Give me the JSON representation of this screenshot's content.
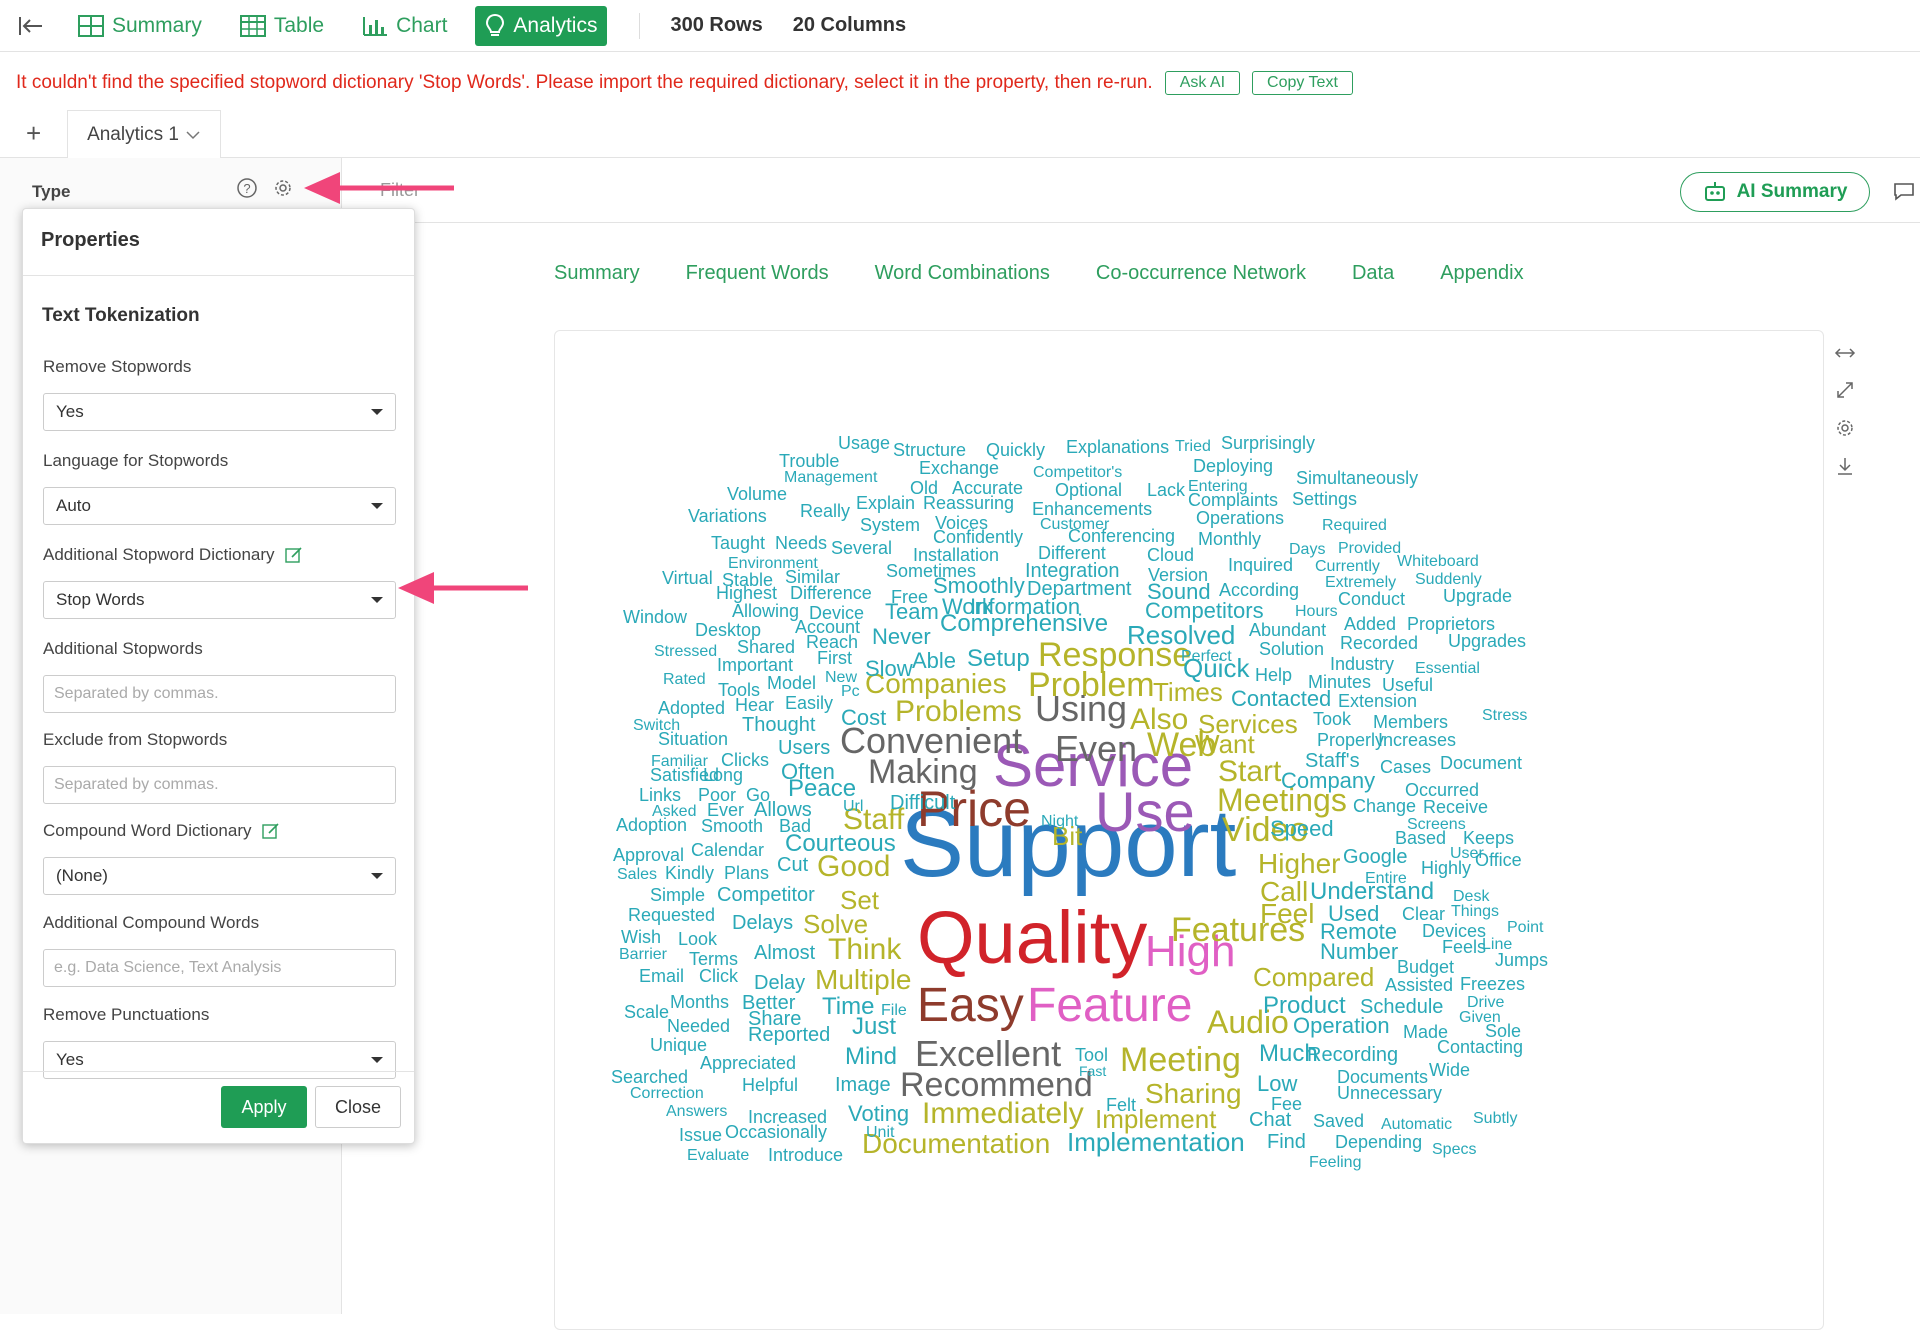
{
  "nav": {
    "summary": "Summary",
    "table": "Table",
    "chart": "Chart",
    "analytics": "Analytics",
    "rows": "300 Rows",
    "columns": "20 Columns"
  },
  "error": {
    "message": "It couldn't find the specified stopword dictionary 'Stop Words'. Please import the required dictionary, select it in the property, then re-run.",
    "ask_ai": "Ask AI",
    "copy_text": "Copy Text"
  },
  "tabs": {
    "add": "+",
    "current": "Analytics 1"
  },
  "toolbar": {
    "type_label": "Type",
    "filter_label": "Filter",
    "ai_summary": "AI Summary"
  },
  "subtabs": [
    "Summary",
    "Frequent Words",
    "Word Combinations",
    "Co-occurrence Network",
    "Data",
    "Appendix"
  ],
  "properties": {
    "title": "Properties",
    "section": "Text Tokenization",
    "remove_stopwords": {
      "label": "Remove Stopwords",
      "value": "Yes"
    },
    "language": {
      "label": "Language for Stopwords",
      "value": "Auto"
    },
    "stopword_dict": {
      "label": "Additional Stopword Dictionary",
      "value": "Stop Words"
    },
    "additional_stopwords": {
      "label": "Additional Stopwords",
      "placeholder": "Separated by commas."
    },
    "exclude_stopwords": {
      "label": "Exclude from Stopwords",
      "placeholder": "Separated by commas."
    },
    "compound_dict": {
      "label": "Compound Word Dictionary",
      "value": "(None)"
    },
    "additional_compound": {
      "label": "Additional Compound Words",
      "placeholder": "e.g. Data Science, Text Analysis"
    },
    "remove_punct": {
      "label": "Remove Punctuations",
      "value": "Yes"
    },
    "apply": "Apply",
    "close": "Close"
  },
  "colors": {
    "accent": "#1f9d55",
    "error": "#e0281b",
    "arrow": "#f0457a"
  },
  "wordcloud": [
    {
      "t": "Support",
      "c": "#2b7bbf"
    },
    {
      "t": "Quality",
      "c": "#d1232a"
    },
    {
      "t": "Service",
      "c": "#9b59b6"
    },
    {
      "t": "Use",
      "c": "#9b59b6"
    },
    {
      "t": "Price",
      "c": "#8e3b2c"
    },
    {
      "t": "Easy",
      "c": "#8e3b2c"
    },
    {
      "t": "Feature",
      "c": "#e05fc4"
    },
    {
      "t": "High",
      "c": "#e05fc4"
    },
    {
      "t": "Features",
      "c": "#b5b42a"
    },
    {
      "t": "Excellent",
      "c": "#666666"
    },
    {
      "t": "Recommend",
      "c": "#666666"
    },
    {
      "t": "Meeting",
      "c": "#b5b42a"
    },
    {
      "t": "Audio",
      "c": "#b5b42a"
    },
    {
      "t": "Video",
      "c": "#b5b42a"
    },
    {
      "t": "Meetings",
      "c": "#b5b42a"
    },
    {
      "t": "Response",
      "c": "#b5b42a"
    },
    {
      "t": "Problem",
      "c": "#b5b42a"
    },
    {
      "t": "Using",
      "c": "#666666"
    },
    {
      "t": "Convenient",
      "c": "#666666"
    },
    {
      "t": "Even",
      "c": "#666666"
    },
    {
      "t": "Web",
      "c": "#b5b42a"
    },
    {
      "t": "Making",
      "c": "#666666"
    },
    {
      "t": "Immediately",
      "c": "#b5b42a"
    },
    {
      "t": "Documentation",
      "c": "#b5b42a"
    },
    {
      "t": "Implementation",
      "c": "#2aa9b8"
    },
    {
      "t": "Sharing",
      "c": "#b5b42a"
    },
    {
      "t": "Implement",
      "c": "#b5b42a"
    },
    {
      "t": "Multiple",
      "c": "#b5b42a"
    },
    {
      "t": "Think",
      "c": "#b5b42a"
    },
    {
      "t": "Staff",
      "c": "#b5b42a"
    },
    {
      "t": "Good",
      "c": "#b5b42a"
    },
    {
      "t": "Companies",
      "c": "#b5b42a"
    },
    {
      "t": "Problems",
      "c": "#b5b42a"
    },
    {
      "t": "Also",
      "c": "#b5b42a"
    },
    {
      "t": "Services",
      "c": "#b5b42a"
    },
    {
      "t": "Start",
      "c": "#b5b42a"
    },
    {
      "t": "Want",
      "c": "#b5b42a"
    },
    {
      "t": "Times",
      "c": "#b5b42a"
    },
    {
      "t": "Higher",
      "c": "#b5b42a"
    },
    {
      "t": "Call",
      "c": "#b5b42a"
    },
    {
      "t": "Feel",
      "c": "#b5b42a"
    },
    {
      "t": "Compared",
      "c": "#b5b42a"
    },
    {
      "t": "Solve",
      "c": "#b5b42a"
    },
    {
      "t": "Set",
      "c": "#b5b42a"
    },
    {
      "t": "Bit",
      "c": "#b5b42a"
    },
    {
      "t": "Resolved",
      "c": "#2aa9b8"
    },
    {
      "t": "Quick",
      "c": "#2aa9b8"
    },
    {
      "t": "Comprehensive",
      "c": "#2aa9b8"
    },
    {
      "t": "Courteous",
      "c": "#2aa9b8"
    },
    {
      "t": "Peace",
      "c": "#2aa9b8"
    },
    {
      "t": "Often",
      "c": "#2aa9b8"
    },
    {
      "t": "Cost",
      "c": "#2aa9b8"
    },
    {
      "t": "Setup",
      "c": "#2aa9b8"
    },
    {
      "t": "Able",
      "c": "#2aa9b8"
    },
    {
      "t": "Slow",
      "c": "#2aa9b8"
    },
    {
      "t": "Never",
      "c": "#2aa9b8"
    },
    {
      "t": "Team",
      "c": "#2aa9b8"
    },
    {
      "t": "Information",
      "c": "#2aa9b8"
    },
    {
      "t": "Work",
      "c": "#2aa9b8"
    },
    {
      "t": "Smoothly",
      "c": "#2aa9b8"
    },
    {
      "t": "Department",
      "c": "#2aa9b8"
    },
    {
      "t": "Sound",
      "c": "#2aa9b8"
    },
    {
      "t": "Competitors",
      "c": "#2aa9b8"
    },
    {
      "t": "Product",
      "c": "#2aa9b8"
    },
    {
      "t": "Schedule",
      "c": "#2aa9b8"
    },
    {
      "t": "Understand",
      "c": "#2aa9b8"
    },
    {
      "t": "Company",
      "c": "#2aa9b8"
    },
    {
      "t": "Speed",
      "c": "#2aa9b8"
    },
    {
      "t": "Google",
      "c": "#2aa9b8"
    },
    {
      "t": "Used",
      "c": "#2aa9b8"
    },
    {
      "t": "Remote",
      "c": "#2aa9b8"
    },
    {
      "t": "Number",
      "c": "#2aa9b8"
    },
    {
      "t": "Operation",
      "c": "#2aa9b8"
    },
    {
      "t": "Much",
      "c": "#2aa9b8"
    },
    {
      "t": "Recording",
      "c": "#2aa9b8"
    },
    {
      "t": "Time",
      "c": "#2aa9b8"
    },
    {
      "t": "Just",
      "c": "#2aa9b8"
    },
    {
      "t": "Mind",
      "c": "#2aa9b8"
    },
    {
      "t": "Image",
      "c": "#2aa9b8"
    },
    {
      "t": "Voting",
      "c": "#2aa9b8"
    },
    {
      "t": "Chat",
      "c": "#2aa9b8"
    },
    {
      "t": "Find",
      "c": "#2aa9b8"
    },
    {
      "t": "Low",
      "c": "#2aa9b8"
    },
    {
      "t": "Contacted",
      "c": "#2aa9b8"
    },
    {
      "t": "Competitor",
      "c": "#2aa9b8"
    },
    {
      "t": "Delays",
      "c": "#2aa9b8"
    },
    {
      "t": "Almost",
      "c": "#2aa9b8"
    },
    {
      "t": "Delay",
      "c": "#2aa9b8"
    },
    {
      "t": "Better",
      "c": "#2aa9b8"
    },
    {
      "t": "Share",
      "c": "#2aa9b8"
    },
    {
      "t": "Reported",
      "c": "#2aa9b8"
    },
    {
      "t": "Appreciated",
      "c": "#2aa9b8"
    },
    {
      "t": "Helpful",
      "c": "#2aa9b8"
    },
    {
      "t": "Increased",
      "c": "#2aa9b8"
    },
    {
      "t": "Occasionally",
      "c": "#2aa9b8"
    },
    {
      "t": "Introduce",
      "c": "#2aa9b8"
    },
    {
      "t": "Calendar",
      "c": "#2aa9b8"
    },
    {
      "t": "Plans",
      "c": "#2aa9b8"
    },
    {
      "t": "Cut",
      "c": "#2aa9b8"
    },
    {
      "t": "Users",
      "c": "#2aa9b8"
    },
    {
      "t": "Thought",
      "c": "#2aa9b8"
    },
    {
      "t": "Easily",
      "c": "#2aa9b8"
    },
    {
      "t": "Hear",
      "c": "#2aa9b8"
    },
    {
      "t": "Tools",
      "c": "#2aa9b8"
    },
    {
      "t": "Model",
      "c": "#2aa9b8"
    },
    {
      "t": "Important",
      "c": "#2aa9b8"
    },
    {
      "t": "Shared",
      "c": "#2aa9b8"
    },
    {
      "t": "Reach",
      "c": "#2aa9b8"
    },
    {
      "t": "Account",
      "c": "#2aa9b8"
    },
    {
      "t": "Desktop",
      "c": "#2aa9b8"
    },
    {
      "t": "Allowing",
      "c": "#2aa9b8"
    },
    {
      "t": "Device",
      "c": "#2aa9b8"
    },
    {
      "t": "Difference",
      "c": "#2aa9b8"
    },
    {
      "t": "Free",
      "c": "#2aa9b8"
    },
    {
      "t": "Highest",
      "c": "#2aa9b8"
    },
    {
      "t": "Stable",
      "c": "#2aa9b8"
    },
    {
      "t": "Similar",
      "c": "#2aa9b8"
    },
    {
      "t": "Sometimes",
      "c": "#2aa9b8"
    },
    {
      "t": "Installation",
      "c": "#2aa9b8"
    },
    {
      "t": "Integration",
      "c": "#2aa9b8"
    },
    {
      "t": "Different",
      "c": "#2aa9b8"
    },
    {
      "t": "Cloud",
      "c": "#2aa9b8"
    },
    {
      "t": "Version",
      "c": "#2aa9b8"
    },
    {
      "t": "According",
      "c": "#2aa9b8"
    },
    {
      "t": "Hours",
      "c": "#2aa9b8"
    },
    {
      "t": "Abundant",
      "c": "#2aa9b8"
    },
    {
      "t": "Solution",
      "c": "#2aa9b8"
    },
    {
      "t": "Help",
      "c": "#2aa9b8"
    },
    {
      "t": "Minutes",
      "c": "#2aa9b8"
    },
    {
      "t": "Extension",
      "c": "#2aa9b8"
    },
    {
      "t": "Took",
      "c": "#2aa9b8"
    },
    {
      "t": "Members",
      "c": "#2aa9b8"
    },
    {
      "t": "Properly",
      "c": "#2aa9b8"
    },
    {
      "t": "Increases",
      "c": "#2aa9b8"
    },
    {
      "t": "Staff's",
      "c": "#2aa9b8"
    },
    {
      "t": "Cases",
      "c": "#2aa9b8"
    },
    {
      "t": "Document",
      "c": "#2aa9b8"
    },
    {
      "t": "Occurred",
      "c": "#2aa9b8"
    },
    {
      "t": "Change",
      "c": "#2aa9b8"
    },
    {
      "t": "Receive",
      "c": "#2aa9b8"
    },
    {
      "t": "Screens",
      "c": "#2aa9b8"
    },
    {
      "t": "Based",
      "c": "#2aa9b8"
    },
    {
      "t": "Keeps",
      "c": "#2aa9b8"
    },
    {
      "t": "User",
      "c": "#2aa9b8"
    },
    {
      "t": "Highly",
      "c": "#2aa9b8"
    },
    {
      "t": "Office",
      "c": "#2aa9b8"
    },
    {
      "t": "Entire",
      "c": "#2aa9b8"
    },
    {
      "t": "Desk",
      "c": "#2aa9b8"
    },
    {
      "t": "Clear",
      "c": "#2aa9b8"
    },
    {
      "t": "Things",
      "c": "#2aa9b8"
    },
    {
      "t": "Point",
      "c": "#2aa9b8"
    },
    {
      "t": "Devices",
      "c": "#2aa9b8"
    },
    {
      "t": "Feels",
      "c": "#2aa9b8"
    },
    {
      "t": "Line",
      "c": "#2aa9b8"
    },
    {
      "t": "Budget",
      "c": "#2aa9b8"
    },
    {
      "t": "Jumps",
      "c": "#2aa9b8"
    },
    {
      "t": "Assisted",
      "c": "#2aa9b8"
    },
    {
      "t": "Freezes",
      "c": "#2aa9b8"
    },
    {
      "t": "Drive",
      "c": "#2aa9b8"
    },
    {
      "t": "Given",
      "c": "#2aa9b8"
    },
    {
      "t": "Made",
      "c": "#2aa9b8"
    },
    {
      "t": "Sole",
      "c": "#2aa9b8"
    },
    {
      "t": "Contacting",
      "c": "#2aa9b8"
    },
    {
      "t": "Documents",
      "c": "#2aa9b8"
    },
    {
      "t": "Wide",
      "c": "#2aa9b8"
    },
    {
      "t": "Unnecessary",
      "c": "#2aa9b8"
    },
    {
      "t": "Fee",
      "c": "#2aa9b8"
    },
    {
      "t": "Saved",
      "c": "#2aa9b8"
    },
    {
      "t": "Automatic",
      "c": "#2aa9b8"
    },
    {
      "t": "Subtly",
      "c": "#2aa9b8"
    },
    {
      "t": "Depending",
      "c": "#2aa9b8"
    },
    {
      "t": "Specs",
      "c": "#2aa9b8"
    },
    {
      "t": "Feeling",
      "c": "#2aa9b8"
    },
    {
      "t": "Felt",
      "c": "#2aa9b8"
    },
    {
      "t": "Tool",
      "c": "#2aa9b8"
    },
    {
      "t": "Fast",
      "c": "#2aa9b8"
    },
    {
      "t": "Unit",
      "c": "#2aa9b8"
    },
    {
      "t": "Night",
      "c": "#2aa9b8"
    },
    {
      "t": "Url",
      "c": "#2aa9b8"
    },
    {
      "t": "Difficult",
      "c": "#2aa9b8"
    },
    {
      "t": "Allows",
      "c": "#2aa9b8"
    },
    {
      "t": "Bad",
      "c": "#2aa9b8"
    },
    {
      "t": "Smooth",
      "c": "#2aa9b8"
    },
    {
      "t": "Ever",
      "c": "#2aa9b8"
    },
    {
      "t": "Asked",
      "c": "#2aa9b8"
    },
    {
      "t": "Links",
      "c": "#2aa9b8"
    },
    {
      "t": "Poor",
      "c": "#2aa9b8"
    },
    {
      "t": "Go",
      "c": "#2aa9b8"
    },
    {
      "t": "Long",
      "c": "#2aa9b8"
    },
    {
      "t": "Satisfied",
      "c": "#2aa9b8"
    },
    {
      "t": "Familiar",
      "c": "#2aa9b8"
    },
    {
      "t": "Clicks",
      "c": "#2aa9b8"
    },
    {
      "t": "Situation",
      "c": "#2aa9b8"
    },
    {
      "t": "Switch",
      "c": "#2aa9b8"
    },
    {
      "t": "Adopted",
      "c": "#2aa9b8"
    },
    {
      "t": "Rated",
      "c": "#2aa9b8"
    },
    {
      "t": "New",
      "c": "#2aa9b8"
    },
    {
      "t": "Pc",
      "c": "#2aa9b8"
    },
    {
      "t": "First",
      "c": "#2aa9b8"
    },
    {
      "t": "Stressed",
      "c": "#2aa9b8"
    },
    {
      "t": "Window",
      "c": "#2aa9b8"
    },
    {
      "t": "Virtual",
      "c": "#2aa9b8"
    },
    {
      "t": "Environment",
      "c": "#2aa9b8"
    },
    {
      "t": "Taught",
      "c": "#2aa9b8"
    },
    {
      "t": "Needs",
      "c": "#2aa9b8"
    },
    {
      "t": "Several",
      "c": "#2aa9b8"
    },
    {
      "t": "Confidently",
      "c": "#2aa9b8"
    },
    {
      "t": "Conferencing",
      "c": "#2aa9b8"
    },
    {
      "t": "Monthly",
      "c": "#2aa9b8"
    },
    {
      "t": "Days",
      "c": "#2aa9b8"
    },
    {
      "t": "Provided",
      "c": "#2aa9b8"
    },
    {
      "t": "Inquired",
      "c": "#2aa9b8"
    },
    {
      "t": "Currently",
      "c": "#2aa9b8"
    },
    {
      "t": "Whiteboard",
      "c": "#2aa9b8"
    },
    {
      "t": "Extremely",
      "c": "#2aa9b8"
    },
    {
      "t": "Suddenly",
      "c": "#2aa9b8"
    },
    {
      "t": "Conduct",
      "c": "#2aa9b8"
    },
    {
      "t": "Upgrade",
      "c": "#2aa9b8"
    },
    {
      "t": "Added",
      "c": "#2aa9b8"
    },
    {
      "t": "Proprietors",
      "c": "#2aa9b8"
    },
    {
      "t": "Recorded",
      "c": "#2aa9b8"
    },
    {
      "t": "Upgrades",
      "c": "#2aa9b8"
    },
    {
      "t": "Perfect",
      "c": "#2aa9b8"
    },
    {
      "t": "Industry",
      "c": "#2aa9b8"
    },
    {
      "t": "Essential",
      "c": "#2aa9b8"
    },
    {
      "t": "Useful",
      "c": "#2aa9b8"
    },
    {
      "t": "Stress",
      "c": "#2aa9b8"
    },
    {
      "t": "Variations",
      "c": "#2aa9b8"
    },
    {
      "t": "Volume",
      "c": "#2aa9b8"
    },
    {
      "t": "Really",
      "c": "#2aa9b8"
    },
    {
      "t": "Explain",
      "c": "#2aa9b8"
    },
    {
      "t": "System",
      "c": "#2aa9b8"
    },
    {
      "t": "Voices",
      "c": "#2aa9b8"
    },
    {
      "t": "Reassuring",
      "c": "#2aa9b8"
    },
    {
      "t": "Enhancements",
      "c": "#2aa9b8"
    },
    {
      "t": "Customer",
      "c": "#2aa9b8"
    },
    {
      "t": "Operations",
      "c": "#2aa9b8"
    },
    {
      "t": "Required",
      "c": "#2aa9b8"
    },
    {
      "t": "Complaints",
      "c": "#2aa9b8"
    },
    {
      "t": "Settings",
      "c": "#2aa9b8"
    },
    {
      "t": "Entering",
      "c": "#2aa9b8"
    },
    {
      "t": "Lack",
      "c": "#2aa9b8"
    },
    {
      "t": "Optional",
      "c": "#2aa9b8"
    },
    {
      "t": "Accurate",
      "c": "#2aa9b8"
    },
    {
      "t": "Old",
      "c": "#2aa9b8"
    },
    {
      "t": "Trouble",
      "c": "#2aa9b8"
    },
    {
      "t": "Management",
      "c": "#2aa9b8"
    },
    {
      "t": "Exchange",
      "c": "#2aa9b8"
    },
    {
      "t": "Competitor's",
      "c": "#2aa9b8"
    },
    {
      "t": "Deploying",
      "c": "#2aa9b8"
    },
    {
      "t": "Simultaneously",
      "c": "#2aa9b8"
    },
    {
      "t": "Usage",
      "c": "#2aa9b8"
    },
    {
      "t": "Structure",
      "c": "#2aa9b8"
    },
    {
      "t": "Quickly",
      "c": "#2aa9b8"
    },
    {
      "t": "Explanations",
      "c": "#2aa9b8"
    },
    {
      "t": "Tried",
      "c": "#2aa9b8"
    },
    {
      "t": "Surprisingly",
      "c": "#2aa9b8"
    },
    {
      "t": "Approval",
      "c": "#2aa9b8"
    },
    {
      "t": "Sales",
      "c": "#2aa9b8"
    },
    {
      "t": "Kindly",
      "c": "#2aa9b8"
    },
    {
      "t": "Adoption",
      "c": "#2aa9b8"
    },
    {
      "t": "Simple",
      "c": "#2aa9b8"
    },
    {
      "t": "Requested",
      "c": "#2aa9b8"
    },
    {
      "t": "Wish",
      "c": "#2aa9b8"
    },
    {
      "t": "Look",
      "c": "#2aa9b8"
    },
    {
      "t": "Barrier",
      "c": "#2aa9b8"
    },
    {
      "t": "Terms",
      "c": "#2aa9b8"
    },
    {
      "t": "Email",
      "c": "#2aa9b8"
    },
    {
      "t": "Click",
      "c": "#2aa9b8"
    },
    {
      "t": "Scale",
      "c": "#2aa9b8"
    },
    {
      "t": "Months",
      "c": "#2aa9b8"
    },
    {
      "t": "Needed",
      "c": "#2aa9b8"
    },
    {
      "t": "Unique",
      "c": "#2aa9b8"
    },
    {
      "t": "File",
      "c": "#2aa9b8"
    },
    {
      "t": "Searched",
      "c": "#2aa9b8"
    },
    {
      "t": "Correction",
      "c": "#2aa9b8"
    },
    {
      "t": "Answers",
      "c": "#2aa9b8"
    },
    {
      "t": "Issue",
      "c": "#2aa9b8"
    },
    {
      "t": "Evaluate",
      "c": "#2aa9b8"
    }
  ]
}
